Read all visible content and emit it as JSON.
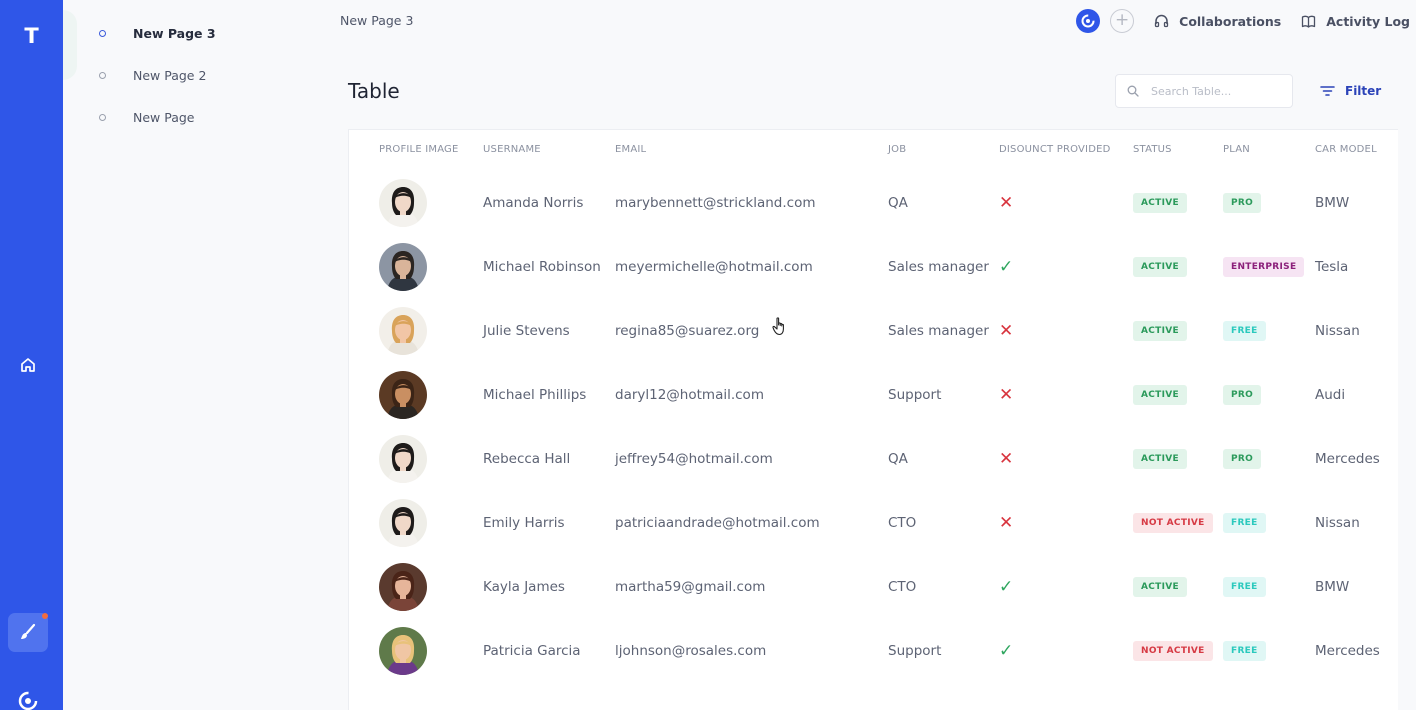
{
  "rail": {
    "logo": "T"
  },
  "tree": [
    {
      "label": "New Page 3",
      "active": true
    },
    {
      "label": "New Page 2",
      "active": false
    },
    {
      "label": "New Page",
      "active": false
    }
  ],
  "breadcrumb": "New Page 3",
  "topbar": {
    "collaborations": "Collaborations",
    "activity_log": "Activity Log"
  },
  "title": "Table",
  "search": {
    "placeholder": "Search Table..."
  },
  "filter_label": "Filter",
  "columns": [
    "PROFILE IMAGE",
    "USERNAME",
    "EMAIL",
    "JOB",
    "DISOUNCT PROVIDED",
    "STATUS",
    "PLAN",
    "CAR MODEL"
  ],
  "rows": [
    {
      "username": "Amanda Norris",
      "email": "marybennett@strickland.com",
      "job": "QA",
      "discount": false,
      "status": "ACTIVE",
      "plan": "PRO",
      "car": "BMW",
      "avatar": "woman-short-hair"
    },
    {
      "username": "Michael Robinson",
      "email": "meyermichelle@hotmail.com",
      "job": "Sales manager",
      "discount": true,
      "status": "ACTIVE",
      "plan": "ENTERPRISE",
      "car": "Tesla",
      "avatar": "man-suit"
    },
    {
      "username": "Julie Stevens",
      "email": "regina85@suarez.org",
      "job": "Sales manager",
      "discount": false,
      "status": "ACTIVE",
      "plan": "FREE",
      "car": "Nissan",
      "avatar": "woman-blonde"
    },
    {
      "username": "Michael Phillips",
      "email": "daryl12@hotmail.com",
      "job": "Support",
      "discount": false,
      "status": "ACTIVE",
      "plan": "PRO",
      "car": "Audi",
      "avatar": "man-beard"
    },
    {
      "username": "Rebecca Hall",
      "email": "jeffrey54@hotmail.com",
      "job": "QA",
      "discount": false,
      "status": "ACTIVE",
      "plan": "PRO",
      "car": "Mercedes",
      "avatar": "woman-short-hair"
    },
    {
      "username": "Emily Harris",
      "email": "patriciaandrade@hotmail.com",
      "job": "CTO",
      "discount": false,
      "status": "NOT ACTIVE",
      "plan": "FREE",
      "car": "Nissan",
      "avatar": "woman-short-hair"
    },
    {
      "username": "Kayla James",
      "email": "martha59@gmail.com",
      "job": "CTO",
      "discount": true,
      "status": "ACTIVE",
      "plan": "FREE",
      "car": "BMW",
      "avatar": "woman-brunette"
    },
    {
      "username": "Patricia Garcia",
      "email": "ljohnson@rosales.com",
      "job": "Support",
      "discount": true,
      "status": "NOT ACTIVE",
      "plan": "FREE",
      "car": "Mercedes",
      "avatar": "woman-blonde-smile"
    }
  ],
  "colors": {
    "rail": "#2f56e8",
    "accent": "#2b43b8",
    "active": "#2b9a5b",
    "inactive": "#d63a44"
  }
}
